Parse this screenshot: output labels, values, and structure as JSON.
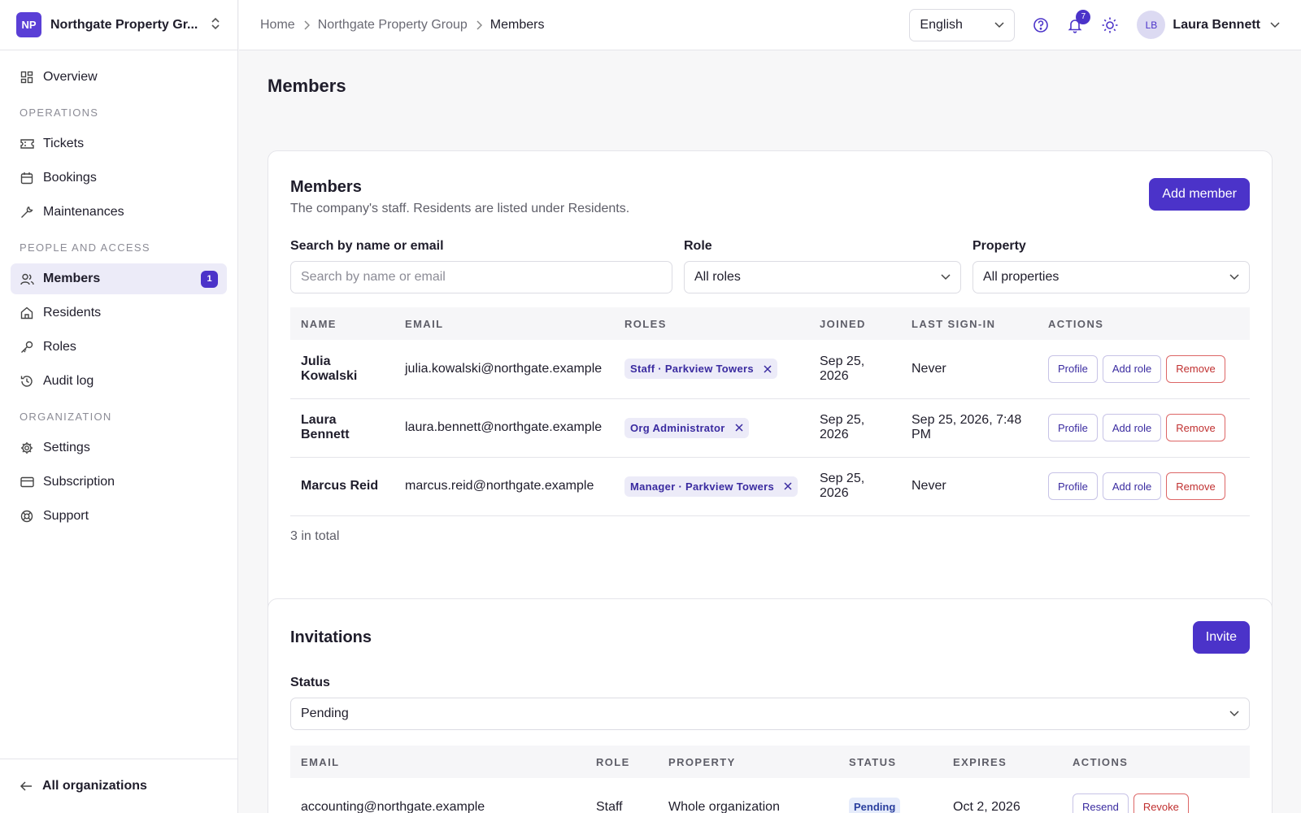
{
  "org": {
    "badge": "NP",
    "name": "Northgate Property Gr..."
  },
  "nav": {
    "overview": "Overview",
    "section_operations": "OPERATIONS",
    "tickets": "Tickets",
    "bookings": "Bookings",
    "maintenances": "Maintenances",
    "section_people": "PEOPLE AND ACCESS",
    "members": "Members",
    "members_count": "1",
    "residents": "Residents",
    "roles": "Roles",
    "audit_log": "Audit log",
    "section_org": "ORGANIZATION",
    "settings": "Settings",
    "subscription": "Subscription",
    "support": "Support",
    "all_orgs": "All organizations"
  },
  "topbar": {
    "crumbs": [
      "Home",
      "Northgate Property Group",
      "Members"
    ],
    "language": "English",
    "notifications": "7",
    "user_initials": "LB",
    "user_name": "Laura Bennett"
  },
  "page": {
    "title": "Members"
  },
  "members_card": {
    "title": "Members",
    "subtitle": "The company's staff. Residents are listed under Residents.",
    "add_button": "Add member",
    "search_label": "Search by name or email",
    "search_placeholder": "Search by name or email",
    "role_label": "Role",
    "role_value": "All roles",
    "property_label": "Property",
    "property_value": "All properties",
    "columns": [
      "NAME",
      "EMAIL",
      "ROLES",
      "JOINED",
      "LAST SIGN-IN",
      "ACTIONS"
    ],
    "rows": [
      {
        "name": "Julia Kowalski",
        "email": "julia.kowalski@northgate.example",
        "role": "Staff · Parkview Towers",
        "joined": "Sep 25, 2026",
        "last": "Never"
      },
      {
        "name": "Laura Bennett",
        "email": "laura.bennett@northgate.example",
        "role": "Org Administrator",
        "joined": "Sep 25, 2026",
        "last": "Sep 25, 2026, 7:48 PM"
      },
      {
        "name": "Marcus Reid",
        "email": "marcus.reid@northgate.example",
        "role": "Manager · Parkview Towers",
        "joined": "Sep 25, 2026",
        "last": "Never"
      }
    ],
    "actions": {
      "profile": "Profile",
      "add_role": "Add role",
      "remove": "Remove"
    },
    "total": "3 in total"
  },
  "invitations_card": {
    "title": "Invitations",
    "invite_button": "Invite",
    "status_label": "Status",
    "status_value": "Pending",
    "columns": [
      "EMAIL",
      "ROLE",
      "PROPERTY",
      "STATUS",
      "EXPIRES",
      "ACTIONS"
    ],
    "rows": [
      {
        "email": "accounting@northgate.example",
        "role": "Staff",
        "property": "Whole organization",
        "status": "Pending",
        "expires": "Oct 2, 2026"
      }
    ],
    "actions": {
      "resend": "Resend",
      "revoke": "Revoke"
    }
  },
  "colors": {
    "accent": "#4b33c9",
    "danger": "#c03030"
  }
}
